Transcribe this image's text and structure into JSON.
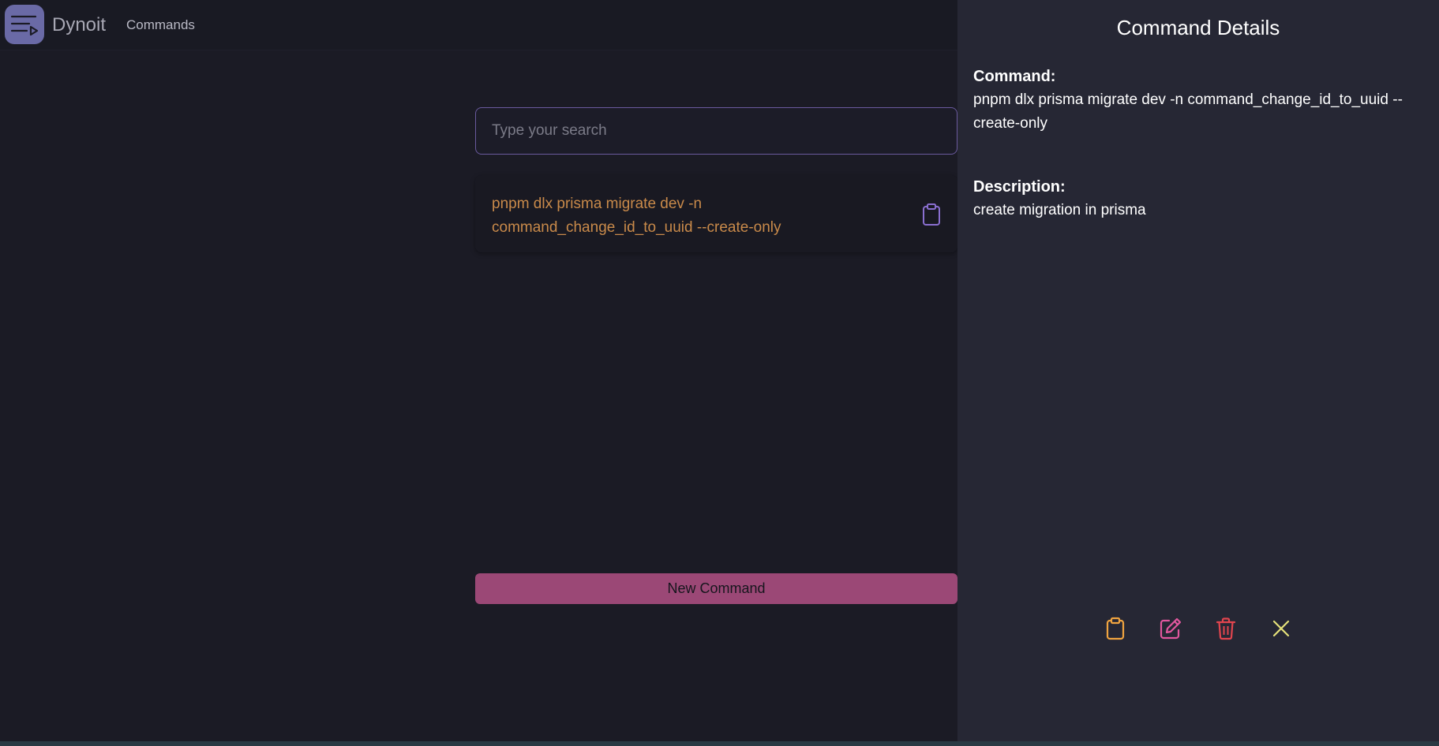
{
  "nav": {
    "brand": "Dynoit",
    "link": "Commands",
    "menu_icon": "menu-play-icon"
  },
  "search": {
    "placeholder": "Type your search",
    "value": ""
  },
  "commands": [
    {
      "command": "pnpm dlx prisma migrate dev -n command_change_id_to_uuid --create-only",
      "copy_icon": "clipboard-icon"
    }
  ],
  "new_command_label": "New Command",
  "details": {
    "title": "Command Details",
    "command_label": "Command:",
    "command_value": "pnpm dlx prisma migrate dev -n command_change_id_to_uuid --create-only",
    "description_label": "Description:",
    "description_value": "create migration in prisma",
    "actions": [
      {
        "name": "copy",
        "icon": "clipboard-icon",
        "color": "#f0a440"
      },
      {
        "name": "edit",
        "icon": "pencil-square-icon",
        "color": "#e2579e"
      },
      {
        "name": "delete",
        "icon": "trash-icon",
        "color": "#e2454e"
      },
      {
        "name": "close",
        "icon": "close-icon",
        "color": "#e6e27a"
      }
    ]
  },
  "colors": {
    "background": "#1b1b25",
    "panel": "#262734",
    "accent": "#9b4876",
    "command_text": "#c98a4a",
    "menu_button": "#6a6aa6"
  }
}
